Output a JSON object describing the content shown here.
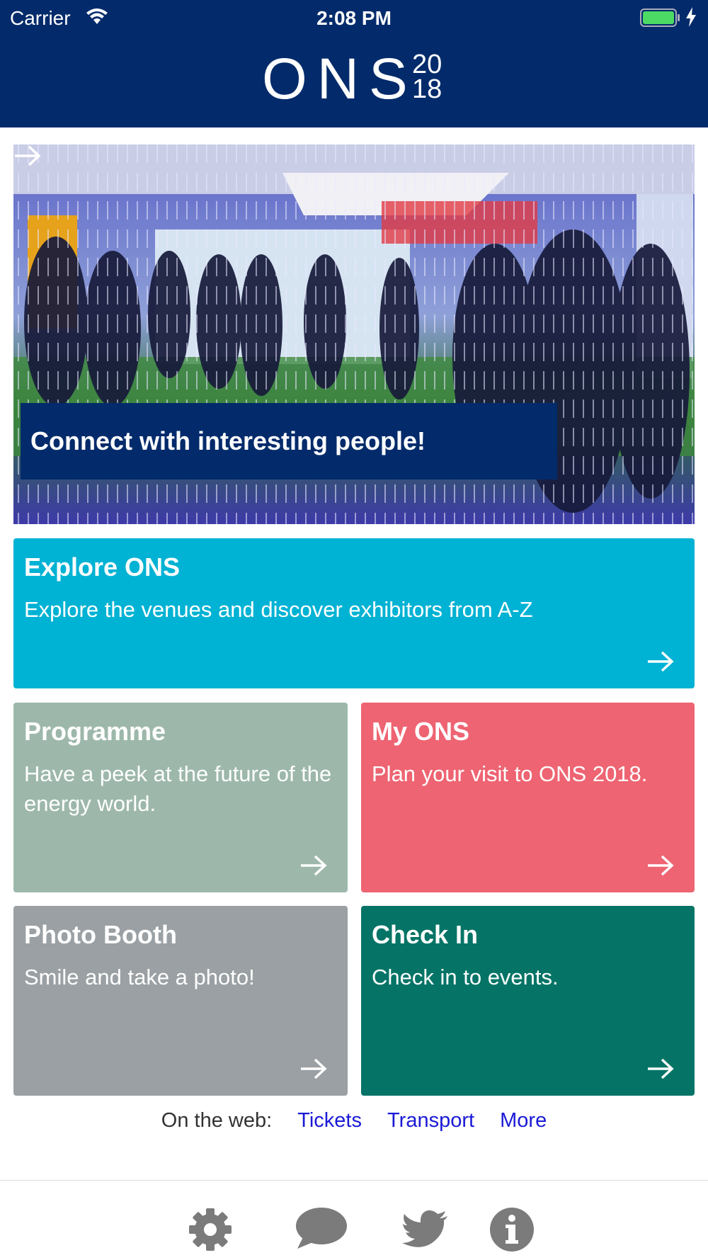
{
  "status_bar": {
    "carrier": "Carrier",
    "time": "2:08 PM"
  },
  "header": {
    "logo_text": "ONS",
    "logo_year_top": "20",
    "logo_year_bottom": "18",
    "background": "#032b6b"
  },
  "hero": {
    "caption": "Connect with interesting people!",
    "caption_background": "#032b6b"
  },
  "tiles": {
    "explore": {
      "title": "Explore ONS",
      "description": "Explore the venues and discover exhibitors from A-Z",
      "color": "#00b2d4"
    },
    "programme": {
      "title": "Programme",
      "description": "Have a peek at the future of the energy world.",
      "color": "#9db8ab"
    },
    "my_ons": {
      "title": "My ONS",
      "description": "Plan your visit to ONS 2018.",
      "color": "#ee6472"
    },
    "photo_booth": {
      "title": "Photo Booth",
      "description": "Smile and take a photo!",
      "color": "#9aa0a3"
    },
    "check_in": {
      "title": "Check In",
      "description": "Check in to events.",
      "color": "#057466"
    }
  },
  "web_links": {
    "label": "On the web:",
    "links": [
      "Tickets",
      "Transport",
      "More"
    ]
  },
  "tab_bar": {
    "icons": [
      "gear-icon",
      "chat-bubble-icon",
      "twitter-bird-icon",
      "info-icon"
    ],
    "icon_color": "#7b7b7b"
  }
}
